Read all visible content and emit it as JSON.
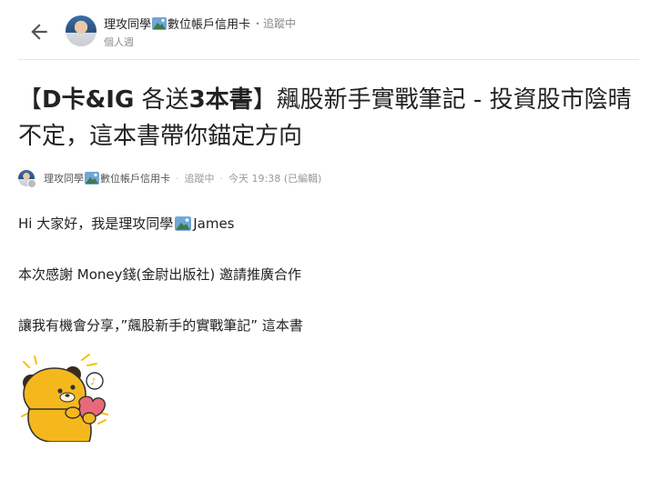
{
  "header": {
    "author": "理攻同學",
    "author_suffix": "數位帳戶信用卡",
    "follow": "・追蹤中",
    "board": "個人週"
  },
  "post": {
    "title_pre": "【",
    "title_bold": "D卡&IG",
    "title_mid": " 各送",
    "title_bold2": "3本書",
    "title_rest": "】飆股新手實戰筆記 - 投資股市陰晴不定，這本書帶你錨定方向",
    "meta_author": "理攻同學",
    "meta_author_suffix": "數位帳戶信用卡",
    "meta_follow": "追蹤中",
    "meta_time": "今天 19:38 (已編輯)",
    "para1_pre": "Hi 大家好，我是理攻同學",
    "para1_post": "James",
    "para2": "本次感謝 Money錢(金尉出版社) 邀請推廣合作",
    "para3": "讓我有機會分享，”飆股新手的實戰筆記” 這本書"
  },
  "colors": {
    "text": "#222222",
    "muted": "#9a9a9a",
    "divider": "#e6e6e6",
    "sticker": "#f5b81c"
  },
  "icons": {
    "back": "arrow-left-icon",
    "badge": "mountain-emoji-icon"
  }
}
